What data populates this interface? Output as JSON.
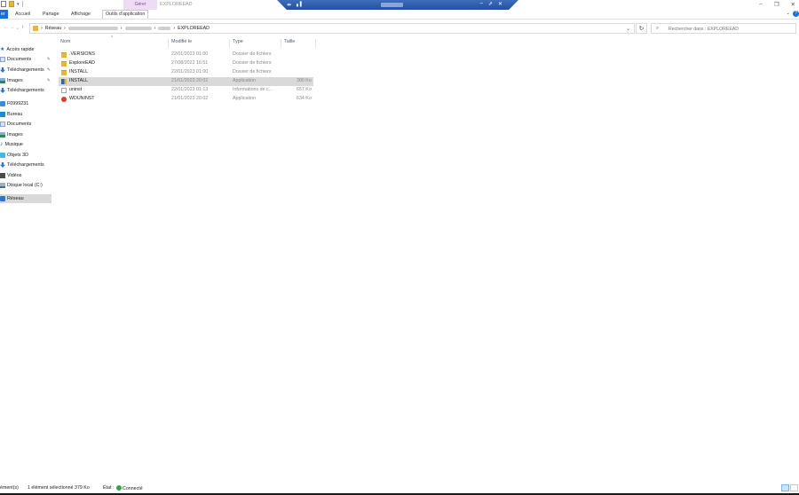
{
  "title_bar": {
    "context_tab": "Gérer",
    "window_title": "EXPLOREEAD",
    "window_controls": [
      "–",
      "❐",
      "✕"
    ]
  },
  "ribbon": {
    "file_tab": "er",
    "tabs": [
      "Accueil",
      "Partage",
      "Affichage"
    ],
    "context_tab": "Outils d'application",
    "help": "?"
  },
  "address": {
    "segments": [
      "Réseau",
      "EXPLOREEAD"
    ],
    "separator": "›"
  },
  "search": {
    "placeholder": "Rechercher dans : EXPLOREEAD"
  },
  "nav_pane": {
    "quick_access": "Accès rapide",
    "quick_items": [
      "Documents",
      "Téléchargements",
      "Images",
      "Téléchargements"
    ],
    "pc": "F0999231",
    "pc_items": [
      "Bureau",
      "Documents",
      "Images",
      "Musique",
      "Objets 3D",
      "Téléchargements",
      "Vidéos",
      "Disque local (C:)"
    ],
    "network": "Réseau"
  },
  "columns": {
    "name": "Nom",
    "modified": "Modifié le",
    "type": "Type",
    "size": "Taille"
  },
  "files": [
    {
      "name": ".VERSIONS",
      "modified": "22/01/2023 01:00",
      "type": "Dossier de fichiers",
      "size": "",
      "icon": "folder-icon"
    },
    {
      "name": "ExploreEAD",
      "modified": "27/08/2022 16:51",
      "type": "Dossier de fichiers",
      "size": "",
      "icon": "folder-icon"
    },
    {
      "name": "INSTALL",
      "modified": "22/01/2023 01:00",
      "type": "Dossier de fichiers",
      "size": "",
      "icon": "folder-icon"
    },
    {
      "name": "INSTALL",
      "modified": "21/01/2023 20:02",
      "type": "Application",
      "size": "380 Ko",
      "icon": "installer-icon"
    },
    {
      "name": "uninst",
      "modified": "22/01/2023 01:13",
      "type": "Informations de c...",
      "size": "657 Ko",
      "icon": "ini-file-icon"
    },
    {
      "name": "WDUNINST",
      "modified": "21/01/2023 20:02",
      "type": "Application",
      "size": "634 Ko",
      "icon": "windev-uninstall-icon"
    }
  ],
  "status": {
    "count": "ément(s)",
    "selection": "1 élément sélectionné  379 Ko",
    "state_label": "État :",
    "state_value": "Connecté"
  },
  "colors": {
    "accent": "#1a6ed8",
    "selection": "#d9d9d9",
    "context_tab_bg": "#eddcf3",
    "remote_bar": "#2d5fb0"
  }
}
